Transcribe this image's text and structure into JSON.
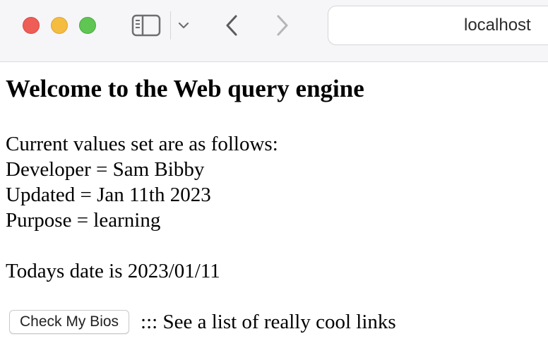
{
  "browser": {
    "url": "localhost",
    "icons": {
      "close": "close-icon",
      "minimize": "minimize-icon",
      "maximize": "maximize-icon",
      "sidebar": "sidebar-icon",
      "chevron_down": "chevron-down-icon",
      "back": "back-arrow-icon",
      "forward": "forward-arrow-icon"
    },
    "colors": {
      "close": "#ee5d56",
      "minimize": "#f4bd40",
      "maximize": "#5fc553"
    }
  },
  "page": {
    "heading": "Welcome to the Web query engine",
    "intro": "Current values set are as follows:",
    "developer": "Developer = Sam Bibby",
    "updated": "Updated = Jan 11th 2023",
    "purpose": "Purpose = learning",
    "today": "Todays date is 2023/01/11",
    "button_label": "Check My Bios",
    "links_text": "::: See a list of really cool links"
  }
}
